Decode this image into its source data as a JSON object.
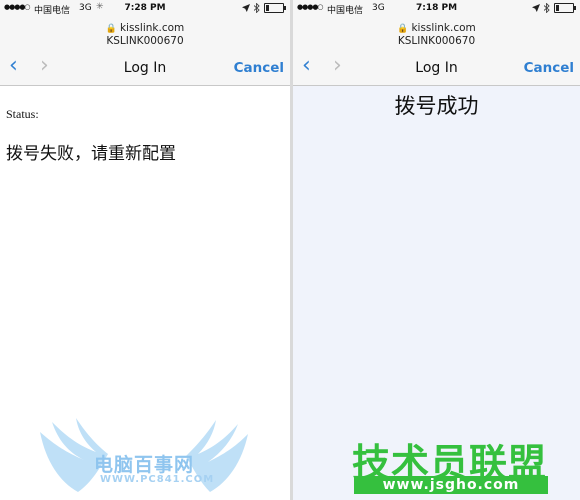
{
  "left_phone": {
    "status_bar": {
      "signal_dots": "●●●●○",
      "carrier": "中国电信",
      "network": "3G",
      "spinner_icon": "activity-spinner-icon",
      "time": "7:28 PM",
      "location_icon": "location-arrow-icon",
      "bluetooth_icon": "bluetooth-icon",
      "battery_level": 0.2
    },
    "url": "kisslink.com",
    "ssid": "KSLINK000670",
    "nav": {
      "back_glyph": "‹",
      "forward_glyph": "›",
      "title": "Log In",
      "cancel_label": "Cancel"
    },
    "content": {
      "status_label": "Status:",
      "message": "拨号失败，请重新配置"
    },
    "watermark": {
      "title": "电脑百事网",
      "url": "WWW.PC841.COM"
    }
  },
  "right_phone": {
    "status_bar": {
      "signal_dots": "●●●●○",
      "carrier": "中国电信",
      "network": "3G",
      "time": "7:18 PM",
      "location_icon": "location-arrow-icon",
      "bluetooth_icon": "bluetooth-icon",
      "battery_level": 0.2
    },
    "url": "kisslink.com",
    "ssid": "KSLINK000670",
    "nav": {
      "back_glyph": "‹",
      "forward_glyph": "›",
      "title": "Log In",
      "cancel_label": "Cancel"
    },
    "content": {
      "message": "拨号成功"
    },
    "watermark": {
      "title": "技术员联盟",
      "url": "www.jsgho.com"
    }
  },
  "colors": {
    "ios_blue": "#2f7fd1",
    "disabled_gray": "#bcbcbc",
    "right_background": "#f0f3fb",
    "watermark_blue": "#8fc5ef",
    "watermark_green": "#35c03e"
  }
}
